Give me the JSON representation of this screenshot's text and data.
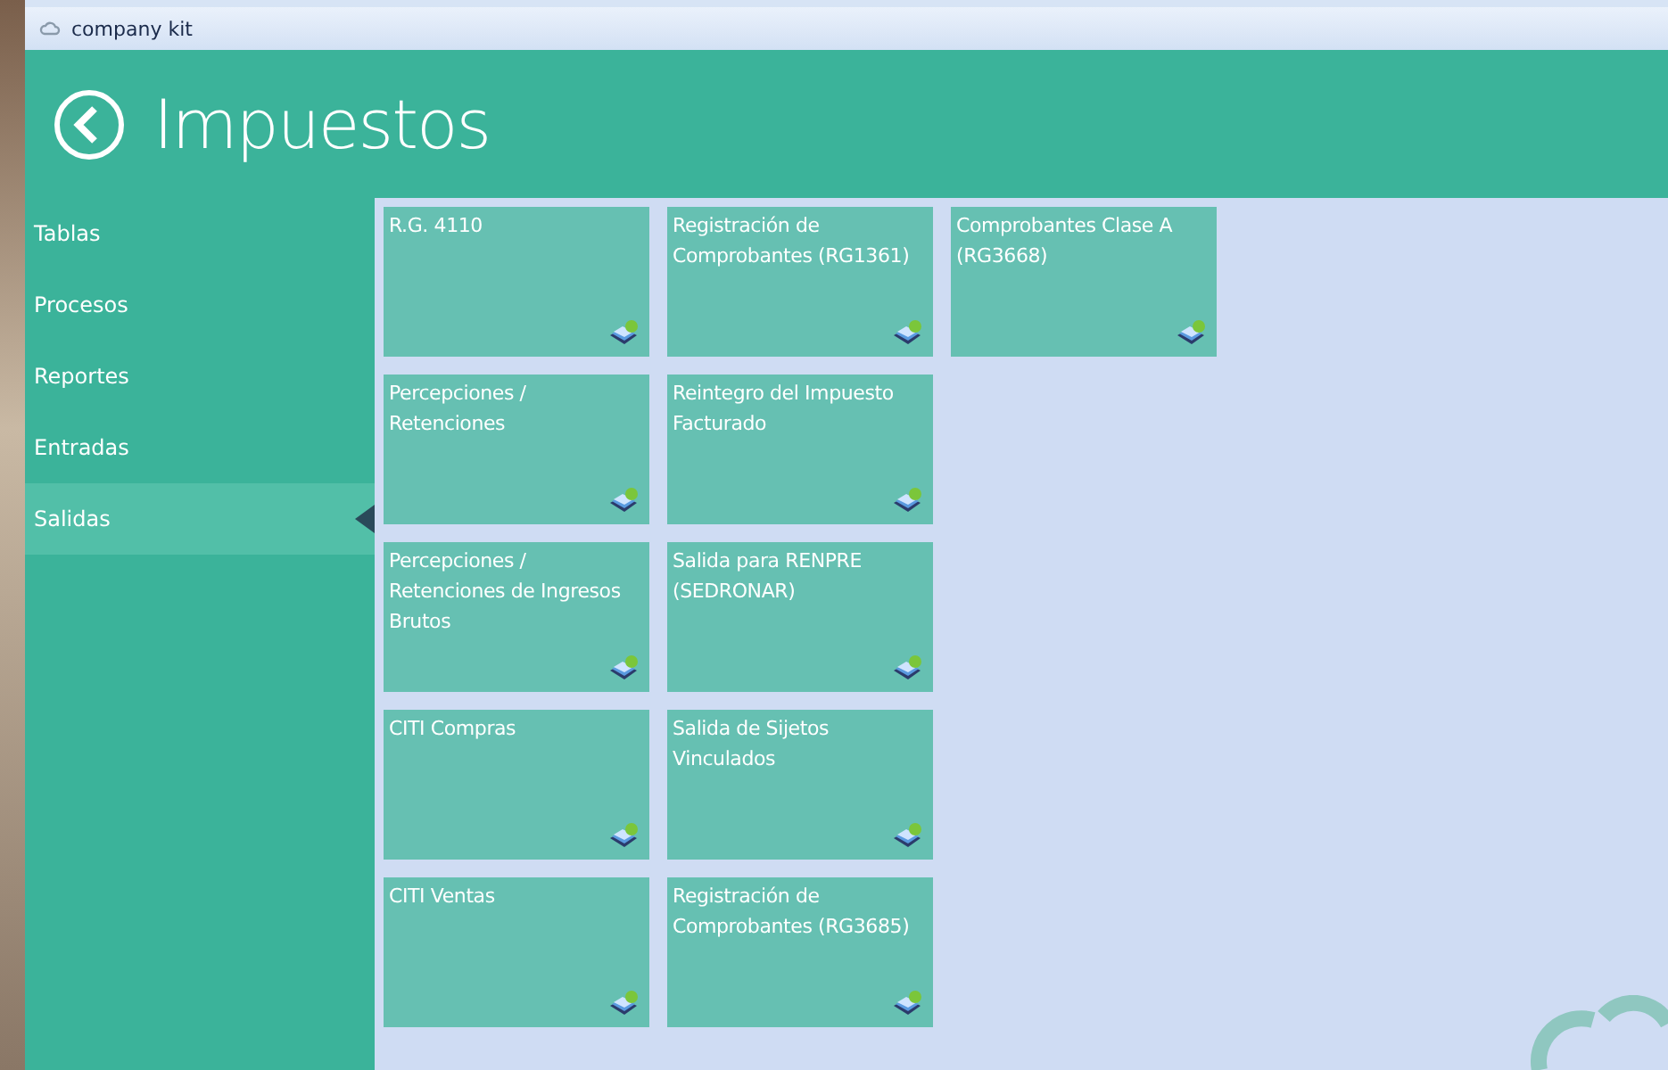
{
  "window": {
    "title": "company kit"
  },
  "header": {
    "title": "Impuestos"
  },
  "sidebar": {
    "items": [
      {
        "label": "Tablas",
        "selected": false
      },
      {
        "label": "Procesos",
        "selected": false
      },
      {
        "label": "Reportes",
        "selected": false
      },
      {
        "label": "Entradas",
        "selected": false
      },
      {
        "label": "Salidas",
        "selected": true
      }
    ]
  },
  "tile_rows": [
    [
      "R.G. 4110",
      "Registración de Comprobantes (RG1361)",
      "Comprobantes Clase A (RG3668)"
    ],
    [
      "Percepciones / Retenciones",
      "Reintegro del Impuesto Facturado"
    ],
    [
      "Percepciones / Retenciones de Ingresos Brutos",
      "Salida para RENPRE (SEDRONAR)"
    ],
    [
      "CITI Compras",
      "Salida de Sijetos Vinculados"
    ],
    [
      "CITI Ventas",
      "Registración de Comprobantes (RG3685)"
    ]
  ]
}
